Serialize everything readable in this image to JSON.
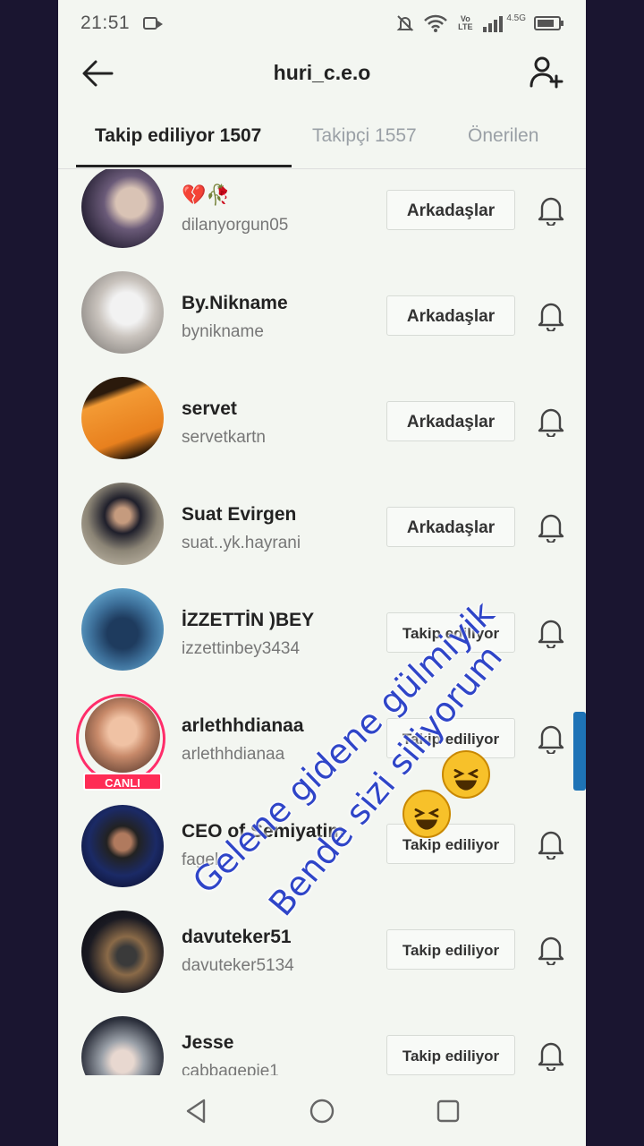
{
  "status": {
    "time": "21:51",
    "network": "4.5G",
    "volte": "Vo LTE"
  },
  "header": {
    "title": "huri_c.e.o"
  },
  "tabs": [
    {
      "label": "Takip ediliyor 1507",
      "active": true
    },
    {
      "label": "Takipçi 1557",
      "active": false
    },
    {
      "label": "Önerilen",
      "active": false
    }
  ],
  "users": [
    {
      "name": "💔🥀",
      "handle": "dilanyorgun05",
      "button": "Arkadaşlar"
    },
    {
      "name": "By.Nikname",
      "handle": "bynikname",
      "button": "Arkadaşlar"
    },
    {
      "name": "servet",
      "handle": "servetkartn",
      "button": "Arkadaşlar"
    },
    {
      "name": "Suat Evirgen",
      "handle": "suat..yk.hayrani",
      "button": "Arkadaşlar"
    },
    {
      "name": "İZZETTİN )BEY",
      "handle": "izzettinbey3434",
      "button": "Takip ediliyor"
    },
    {
      "name": "arlethhdianaa",
      "handle": "arlethhdianaa",
      "button": "Takip ediliyor",
      "live": "CANLI"
    },
    {
      "name": "CEO of Semiyatim",
      "handle": "fagel",
      "button": "Takip ediliyor"
    },
    {
      "name": "davuteker51",
      "handle": "davuteker5134",
      "button": "Takip ediliyor"
    },
    {
      "name": "Jesse",
      "handle": "cabbagepie1",
      "button": "Takip ediliyor"
    }
  ],
  "overlay": {
    "line1": "Gelene gidene gülmiyik",
    "line2": "Bende sizi siliyorum"
  },
  "icons": [
    "back-arrow-icon",
    "add-user-icon",
    "bell-icon",
    "nav-back-icon",
    "nav-home-icon",
    "nav-recents-icon",
    "laughing-emoji-icon"
  ],
  "colors": {
    "overlay_text": "#2f45c8",
    "live": "#fe2c55",
    "scroll": "#1e73b6"
  }
}
